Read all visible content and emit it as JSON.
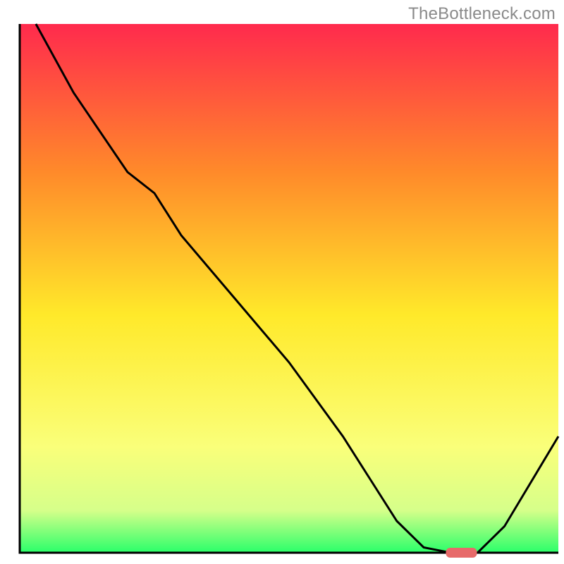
{
  "watermark": "TheBottleneck.com",
  "chart_data": {
    "type": "line",
    "title": "",
    "xlabel": "",
    "ylabel": "",
    "xlim": [
      0,
      100
    ],
    "ylim": [
      0,
      100
    ],
    "x": [
      3,
      10,
      20,
      25,
      30,
      40,
      50,
      60,
      65,
      70,
      75,
      80,
      85,
      90,
      100
    ],
    "values": [
      100,
      87,
      72,
      68,
      60,
      48,
      36,
      22,
      14,
      6,
      1,
      0,
      0,
      5,
      22
    ],
    "optimum_marker": {
      "x": 82,
      "y": 0
    },
    "background_gradient": {
      "top": "#ff2a4d",
      "mid_upper": "#ff8a2a",
      "mid": "#ffe92a",
      "mid_lower": "#faff7a",
      "low": "#d6ff8a",
      "bottom": "#2aff6a"
    },
    "colors": {
      "axis": "#000000",
      "curve": "#000000",
      "marker": "#e76a6a"
    }
  }
}
